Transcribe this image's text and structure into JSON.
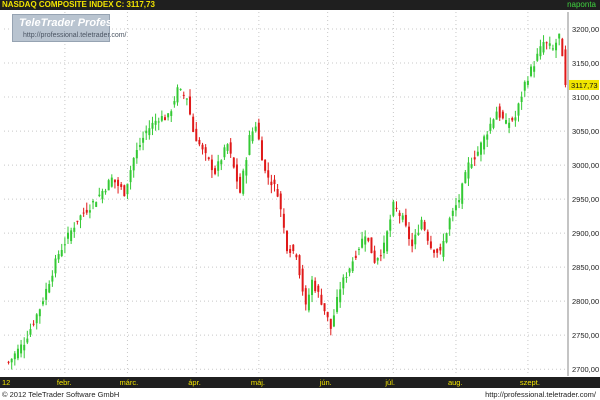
{
  "header": {
    "title": "NASDAQ COMPOSITE INDEX  C: 3117,73",
    "period": "naponta"
  },
  "logo": {
    "brand": "TeleTrader Professional",
    "url": "http://professional.teletrader.com/"
  },
  "footer": {
    "copyright": "© 2012 TeleTrader Software GmbH",
    "site": "http://professional.teletrader.com/"
  },
  "colors": {
    "up": "#34c934",
    "down": "#e01919",
    "grid": "#c8c8c8",
    "price_tag_bg": "#f0e400",
    "axis_band": "#1f1f1f"
  },
  "chart_data": {
    "type": "candlestick",
    "title": "NASDAQ COMPOSITE INDEX",
    "last_close_label": "3117,73",
    "last_close": 3117.73,
    "ylim": [
      2690,
      3225
    ],
    "y_ticks": [
      {
        "value": 2700,
        "label": "2700,00"
      },
      {
        "value": 2750,
        "label": "2750,00"
      },
      {
        "value": 2800,
        "label": "2800,00"
      },
      {
        "value": 2850,
        "label": "2850,00"
      },
      {
        "value": 2900,
        "label": "2900,00"
      },
      {
        "value": 2950,
        "label": "2950,00"
      },
      {
        "value": 3000,
        "label": "3000,00"
      },
      {
        "value": 3050,
        "label": "3050,00"
      },
      {
        "value": 3100,
        "label": "3100,00"
      },
      {
        "value": 3150,
        "label": "3150,00"
      },
      {
        "value": 3200,
        "label": "3200,00"
      }
    ],
    "x_ticks": [
      {
        "index": 0,
        "label": "12"
      },
      {
        "index": 18,
        "label": "febr."
      },
      {
        "index": 38,
        "label": "márc."
      },
      {
        "index": 60,
        "label": "ápr."
      },
      {
        "index": 80,
        "label": "máj."
      },
      {
        "index": 102,
        "label": "jún."
      },
      {
        "index": 123,
        "label": "júl."
      },
      {
        "index": 143,
        "label": "aug."
      },
      {
        "index": 166,
        "label": "szept."
      }
    ],
    "anchors": [
      [
        0,
        2710
      ],
      [
        5,
        2740
      ],
      [
        10,
        2790
      ],
      [
        16,
        2870
      ],
      [
        22,
        2920
      ],
      [
        28,
        2950
      ],
      [
        33,
        2980
      ],
      [
        37,
        2960
      ],
      [
        40,
        3010
      ],
      [
        44,
        3050
      ],
      [
        48,
        3070
      ],
      [
        51,
        3070
      ],
      [
        54,
        3110
      ],
      [
        57,
        3100
      ],
      [
        59,
        3050
      ],
      [
        62,
        3020
      ],
      [
        66,
        2990
      ],
      [
        70,
        3030
      ],
      [
        74,
        2960
      ],
      [
        77,
        3040
      ],
      [
        79,
        3060
      ],
      [
        82,
        2990
      ],
      [
        86,
        2960
      ],
      [
        89,
        2880
      ],
      [
        92,
        2870
      ],
      [
        95,
        2790
      ],
      [
        97,
        2830
      ],
      [
        100,
        2800
      ],
      [
        103,
        2760
      ],
      [
        106,
        2820
      ],
      [
        110,
        2860
      ],
      [
        114,
        2900
      ],
      [
        117,
        2860
      ],
      [
        120,
        2880
      ],
      [
        123,
        2940
      ],
      [
        126,
        2920
      ],
      [
        129,
        2880
      ],
      [
        132,
        2920
      ],
      [
        135,
        2880
      ],
      [
        138,
        2870
      ],
      [
        141,
        2920
      ],
      [
        144,
        2950
      ],
      [
        147,
        3000
      ],
      [
        150,
        3020
      ],
      [
        153,
        3050
      ],
      [
        156,
        3080
      ],
      [
        159,
        3060
      ],
      [
        162,
        3070
      ],
      [
        165,
        3120
      ],
      [
        168,
        3150
      ],
      [
        171,
        3180
      ],
      [
        174,
        3170
      ],
      [
        176,
        3190
      ],
      [
        178,
        3117.73
      ]
    ]
  }
}
